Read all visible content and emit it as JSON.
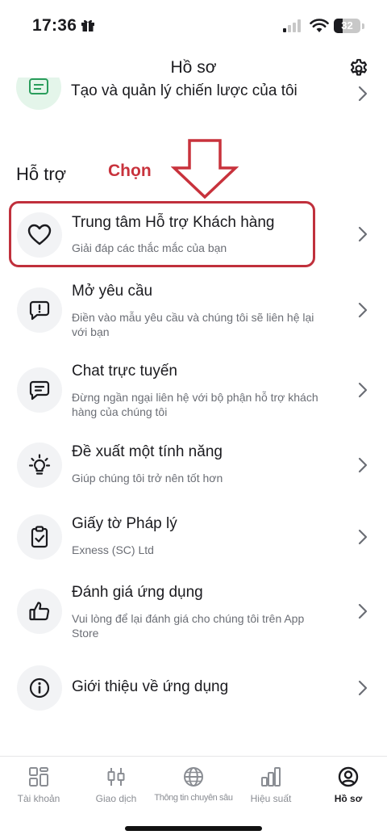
{
  "status_bar": {
    "time": "17:36",
    "battery": "32",
    "battery_level": 0.32
  },
  "header": {
    "title": "Hồ sơ"
  },
  "partial_item": {
    "title": "Tạo và quản lý chiến lược của tôi"
  },
  "section": {
    "title": "Hỗ trợ"
  },
  "annotation": {
    "label": "Chọn",
    "color": "#c8323c"
  },
  "items": [
    {
      "title": "Trung tâm Hỗ trợ Khách hàng",
      "subtitle": "Giải đáp các thắc mắc của bạn",
      "icon": "heart-icon"
    },
    {
      "title": "Mở yêu cầu",
      "subtitle": "Điền vào mẫu yêu cầu và chúng tôi sẽ liên hệ lại với bạn",
      "icon": "request-bubble-icon"
    },
    {
      "title": "Chat trực tuyến",
      "subtitle": "Đừng ngần ngại liên hệ với bộ phận hỗ trợ khách hàng của chúng tôi",
      "icon": "chat-bubble-icon"
    },
    {
      "title": "Đề xuất một tính năng",
      "subtitle": "Giúp chúng tôi trở nên tốt hơn",
      "icon": "lightbulb-icon"
    },
    {
      "title": "Giấy tờ Pháp lý",
      "subtitle": "Exness (SC) Ltd",
      "icon": "clipboard-check-icon"
    },
    {
      "title": "Đánh giá ứng dụng",
      "subtitle": "Vui lòng để lại đánh giá cho chúng tôi trên App Store",
      "icon": "thumbs-up-icon"
    },
    {
      "title": "Giới thiệu về ứng dụng",
      "subtitle": "",
      "icon": "info-icon"
    }
  ],
  "tabs": [
    {
      "label": "Tài khoản",
      "icon": "accounts-grid-icon",
      "active": false
    },
    {
      "label": "Giao dịch",
      "icon": "trade-candles-icon",
      "active": false
    },
    {
      "label": "Thông tin chuyên sâu",
      "icon": "globe-icon",
      "active": false
    },
    {
      "label": "Hiệu suất",
      "icon": "bar-chart-icon",
      "active": false
    },
    {
      "label": "Hồ sơ",
      "icon": "profile-icon",
      "active": true
    }
  ],
  "colors": {
    "accent_green": "#e4f5ea",
    "icon_bg": "#f2f3f5",
    "highlight": "#c0303c"
  }
}
